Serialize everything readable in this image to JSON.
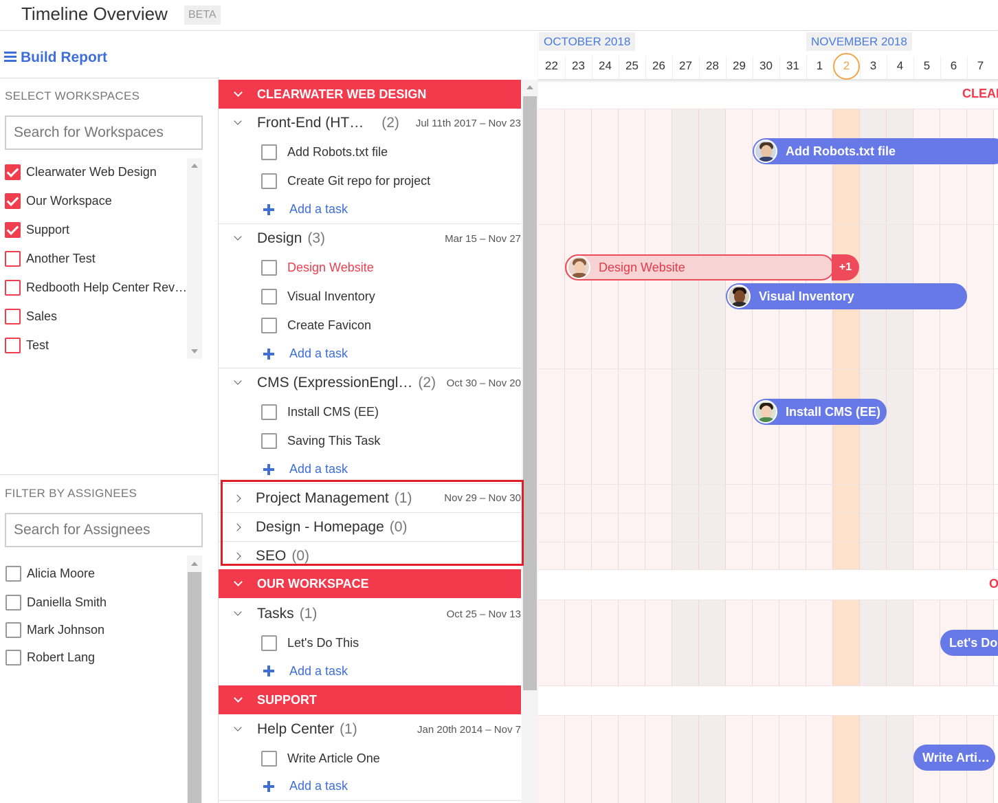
{
  "header": {
    "title": "Timeline Overview",
    "badge": "BETA"
  },
  "build_report": "Build Report",
  "workspaces": {
    "section_label": "SELECT WORKSPACES",
    "search_placeholder": "Search for Workspaces",
    "items": [
      {
        "label": "Clearwater Web Design",
        "checked": true
      },
      {
        "label": "Our Workspace",
        "checked": true
      },
      {
        "label": "Support",
        "checked": true
      },
      {
        "label": "Another Test",
        "checked": false
      },
      {
        "label": "Redbooth Help Center Rev…",
        "checked": false
      },
      {
        "label": "Sales",
        "checked": false
      },
      {
        "label": "Test",
        "checked": false
      }
    ]
  },
  "assignees": {
    "section_label": "FILTER BY ASSIGNEES",
    "search_placeholder": "Search for Assignees",
    "items": [
      {
        "label": "Alicia Moore"
      },
      {
        "label": "Daniella Smith"
      },
      {
        "label": "Mark Johnson"
      },
      {
        "label": "Robert Lang"
      }
    ]
  },
  "tasklist": {
    "add_task_label": "Add a task",
    "ws1": {
      "name": "CLEARWATER WEB DESIGN",
      "groups": [
        {
          "name": "Front-End (HT…",
          "count": "(2)",
          "dates": "Jul 11th 2017 – Nov 23",
          "tasks": [
            "Add Robots.txt file",
            "Create Git repo for project"
          ]
        },
        {
          "name": "Design",
          "count": "(3)",
          "dates": "Mar 15 – Nov 27",
          "tasks": [
            "Design Website",
            "Visual Inventory",
            "Create Favicon"
          ]
        },
        {
          "name": "CMS (ExpressionEngl…",
          "count": "(2)",
          "dates": "Oct 30 – Nov 20",
          "tasks": [
            "Install CMS (EE)",
            "Saving This Task"
          ]
        },
        {
          "name": "Project Management",
          "count": "(1)",
          "dates": "Nov 29 – Nov 30"
        },
        {
          "name": "Design - Homepage",
          "count": "(0)"
        },
        {
          "name": "SEO",
          "count": "(0)"
        }
      ]
    },
    "ws2": {
      "name": "OUR WORKSPACE",
      "groups": [
        {
          "name": "Tasks",
          "count": "(1)",
          "dates": "Oct 25 – Nov 13",
          "tasks": [
            "Let's Do This"
          ]
        }
      ]
    },
    "ws3": {
      "name": "SUPPORT",
      "groups": [
        {
          "name": "Help Center",
          "count": "(1)",
          "dates": "Jan 20th 2014 – Nov 7",
          "tasks": [
            "Write Article One"
          ]
        }
      ]
    }
  },
  "timeline": {
    "months": [
      "OCTOBER 2018",
      "NOVEMBER 2018"
    ],
    "days": [
      "22",
      "23",
      "24",
      "25",
      "26",
      "27",
      "28",
      "29",
      "30",
      "31",
      "1",
      "2",
      "3",
      "4",
      "5",
      "6",
      "7"
    ],
    "today": "2",
    "ws_labels": [
      "CLEAR",
      "O"
    ],
    "bars": [
      {
        "label": "Add Robots.txt file",
        "color": "#6779e6"
      },
      {
        "label": "Design Website",
        "extra": "+1",
        "color": "#f7d3d3"
      },
      {
        "label": "Visual Inventory",
        "color": "#6779e6"
      },
      {
        "label": "Install CMS (EE)",
        "color": "#6779e6"
      },
      {
        "label": "Let's Do This",
        "color": "#6779e6"
      },
      {
        "label": "Write Arti…",
        "color": "#6779e6"
      }
    ]
  },
  "colors": {
    "accent_red": "#f23a4c",
    "link_blue": "#3f6ed8",
    "bar_blue": "#6779e6",
    "today_orange": "#f0a64b"
  }
}
